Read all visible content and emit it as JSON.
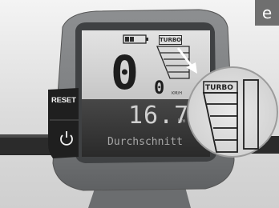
{
  "panel_letter": "e",
  "device": {
    "reset_label": "RESET",
    "power_icon": "power-icon"
  },
  "display": {
    "mode_small": "TURBO",
    "speed_large": "0",
    "speed_small": "0",
    "speed_unit": "KM/H",
    "trip_value": "16.7",
    "trip_unit": "km",
    "trip_label": "Durchschnitt",
    "battery_icon": "battery-icon",
    "assist_bars_icon": "assist-level-bars-icon"
  },
  "zoom": {
    "mode_label": "TURBO",
    "arrow_icon": "arrow-icon"
  },
  "colors": {
    "housing": "#7a7c7e",
    "lcd": "#d7d7d7",
    "lcd_lower": "#3d3d3d"
  }
}
